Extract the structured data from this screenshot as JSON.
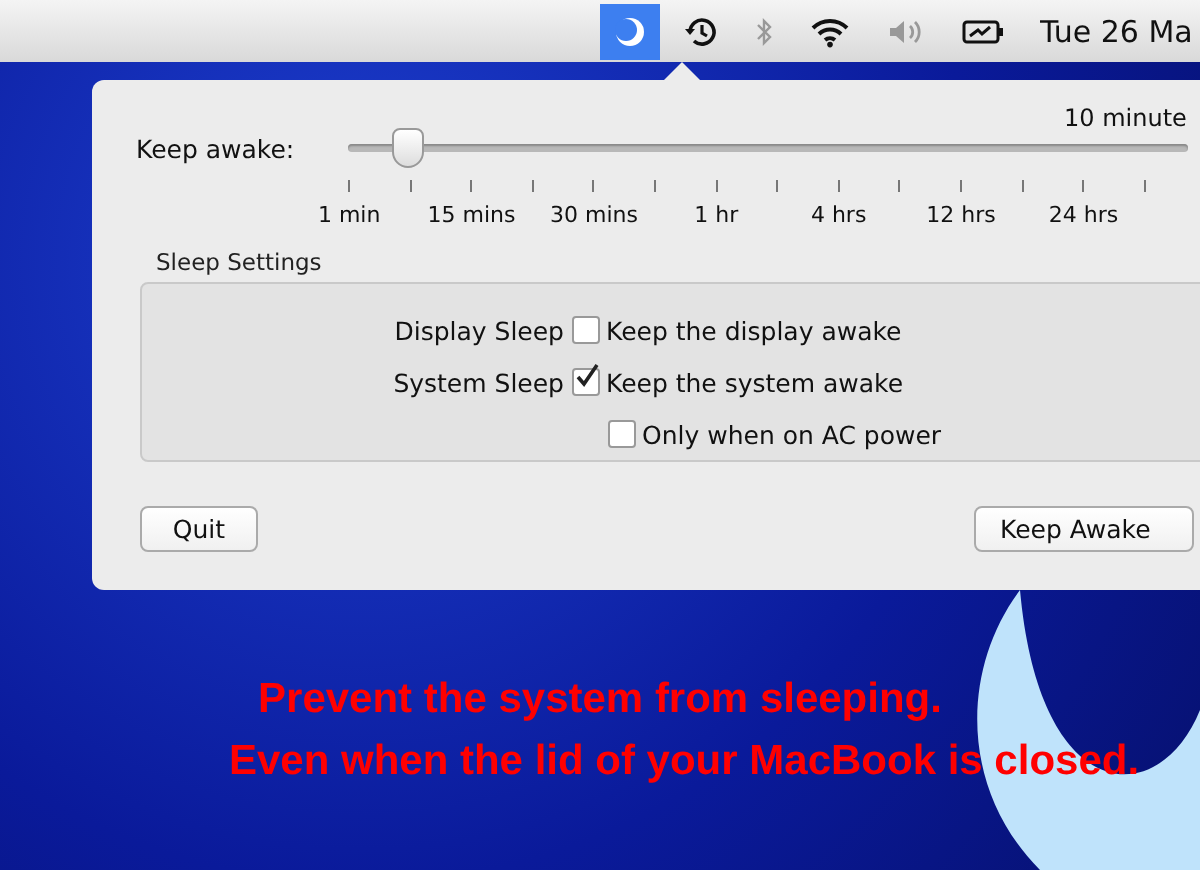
{
  "menu_bar": {
    "items": [
      {
        "kind": "moon",
        "selected": true,
        "disabled": false
      },
      {
        "kind": "time-machine",
        "selected": false,
        "disabled": false
      },
      {
        "kind": "bluetooth",
        "selected": false,
        "disabled": true
      },
      {
        "kind": "wifi",
        "selected": false,
        "disabled": false
      },
      {
        "kind": "volume",
        "selected": false,
        "disabled": true
      },
      {
        "kind": "battery",
        "selected": false,
        "disabled": false
      }
    ],
    "clock": "Tue 26 Ma"
  },
  "popover": {
    "duration": "10 minute",
    "slider_label": "Keep awake:",
    "slider": {
      "level": 0.072
    },
    "tick_labels": [
      "1 min",
      "15 mins",
      "30 mins",
      "1 hr",
      "4 hrs",
      "12 hrs",
      "24 hrs"
    ],
    "sleep_settings": {
      "title": "Sleep Settings",
      "rows": [
        {
          "kind": "labeled",
          "label": "Display Sleep",
          "option": "Keep the display awake",
          "checked": false
        },
        {
          "kind": "labeled",
          "label": "System Sleep",
          "option": "Keep the system awake",
          "checked": true
        },
        {
          "kind": "indented",
          "option": "Only when on AC power",
          "checked": false
        }
      ]
    },
    "buttons": [
      {
        "kind": "left",
        "label": "Quit"
      },
      {
        "kind": "right",
        "label": "Keep Awake"
      }
    ]
  },
  "caption": [
    "Prevent the system from sleeping.",
    "Even when the lid of your MacBook is closed."
  ]
}
